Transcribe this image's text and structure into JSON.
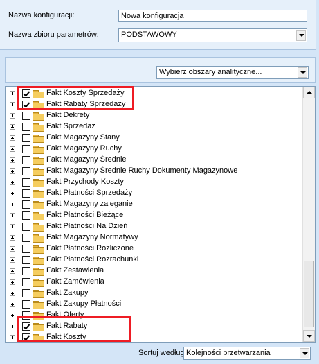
{
  "config": {
    "name_label": "Nazwa konfiguracji:",
    "name_value": "Nowa konfiguracja",
    "paramset_label": "Nazwa zbioru parametrów:",
    "paramset_value": "PODSTAWOWY"
  },
  "analytics": {
    "select_value": "Wybierz obszary analityczne..."
  },
  "tree": {
    "items": [
      {
        "label": "Fakt Koszty Sprzedaży",
        "checked": true
      },
      {
        "label": "Fakt Rabaty Sprzedaży",
        "checked": true
      },
      {
        "label": "Fakt Dekrety",
        "checked": false
      },
      {
        "label": "Fakt Sprzedaż",
        "checked": false
      },
      {
        "label": "Fakt Magazyny Stany",
        "checked": false
      },
      {
        "label": "Fakt Magazyny Ruchy",
        "checked": false
      },
      {
        "label": "Fakt Magazyny Średnie",
        "checked": false
      },
      {
        "label": "Fakt Magazyny Średnie Ruchy Dokumenty Magazynowe",
        "checked": false
      },
      {
        "label": "Fakt Przychody Koszty",
        "checked": false
      },
      {
        "label": "Fakt Płatności Sprzedaży",
        "checked": false
      },
      {
        "label": "Fakt Magazyny zaleganie",
        "checked": false
      },
      {
        "label": "Fakt Płatności Bieżące",
        "checked": false
      },
      {
        "label": "Fakt Płatności Na Dzień",
        "checked": false
      },
      {
        "label": "Fakt Magazyny Normatywy",
        "checked": false
      },
      {
        "label": "Fakt Płatności Rozliczone",
        "checked": false
      },
      {
        "label": "Fakt Płatności Rozrachunki",
        "checked": false
      },
      {
        "label": "Fakt Zestawienia",
        "checked": false
      },
      {
        "label": "Fakt Zamówienia",
        "checked": false
      },
      {
        "label": "Fakt Zakupy",
        "checked": false
      },
      {
        "label": "Fakt Zakupy Płatności",
        "checked": false
      },
      {
        "label": "Fakt Oferty",
        "checked": false
      },
      {
        "label": "Fakt Rabaty",
        "checked": true
      },
      {
        "label": "Fakt Koszty",
        "checked": true
      }
    ]
  },
  "sort": {
    "label": "Sortuj według:",
    "value": "Kolejności przetwarzania"
  },
  "colors": {
    "highlight": "#ee1c24",
    "panel_bg": "#e6f0fa",
    "window_bg": "#d4e5f7"
  }
}
